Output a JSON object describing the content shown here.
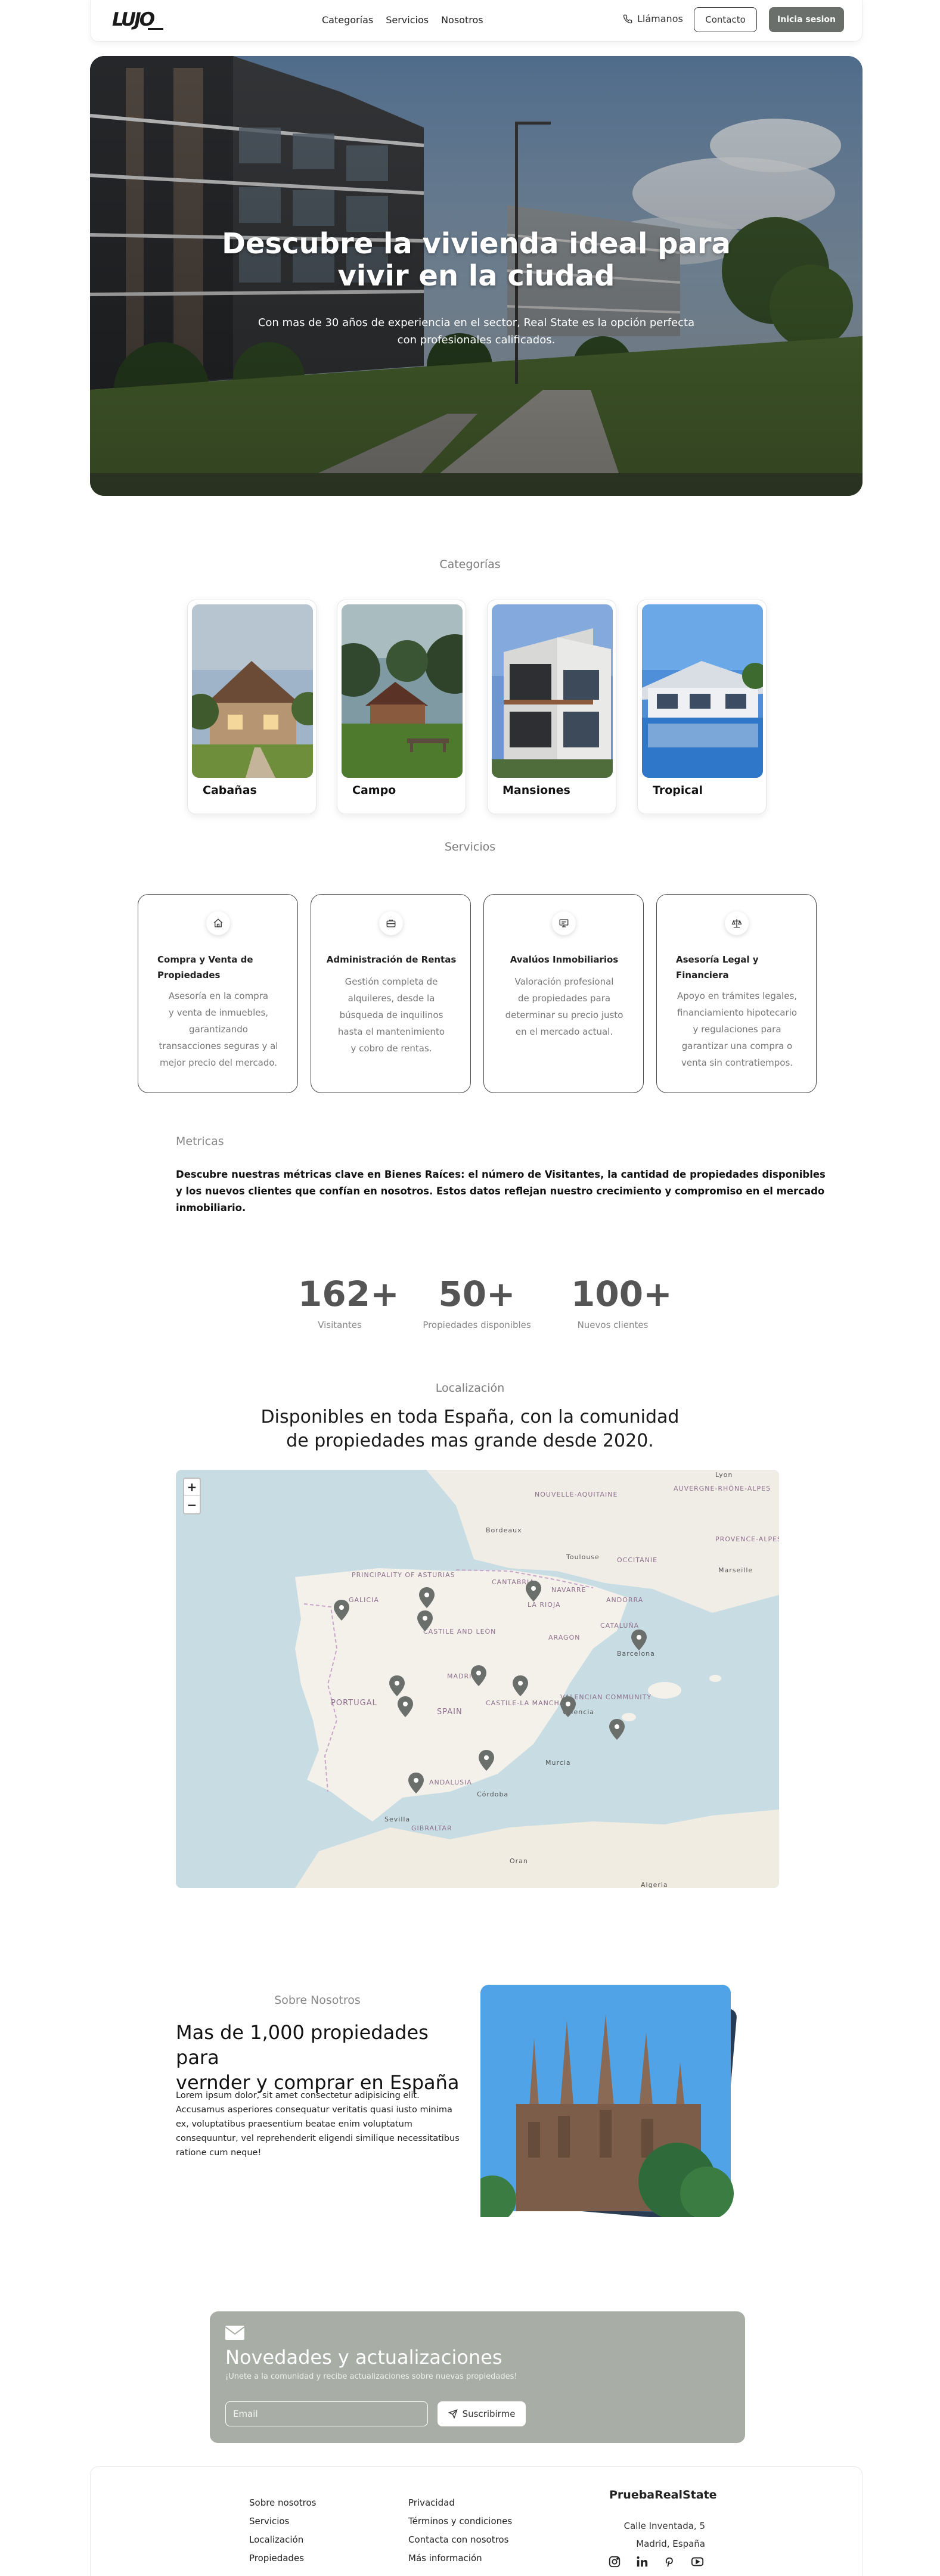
{
  "nav": {
    "logo_text": "LUJO",
    "links": [
      "Categorías",
      "Servicios",
      "Nosotros"
    ],
    "call_label": "Llámanos",
    "contact_label": "Contacto",
    "login_label": "Inicia sesion"
  },
  "hero": {
    "title_line1": "Descubre la vivienda ideal para",
    "title_line2": "vivir en la ciudad",
    "subtitle_line1": "Con mas de 30 años de experiencia en el sector, Real State es la opción perfecta",
    "subtitle_line2": "con profesionales calificados."
  },
  "categories": {
    "label": "Categorías",
    "items": [
      "Cabañas",
      "Campo",
      "Mansiones",
      "Tropical"
    ]
  },
  "services": {
    "label": "Servicios",
    "items": [
      {
        "title_lines": [
          "Compra y Venta de",
          "Propiedades"
        ],
        "icon": "home-icon",
        "desc_lines": [
          "Asesoría en la compra",
          "y venta de inmuebles,",
          "garantizando",
          "transacciones seguras y al",
          "mejor precio del mercado."
        ]
      },
      {
        "title_lines": [
          "Administración de Rentas"
        ],
        "icon": "briefcase-icon",
        "desc_lines": [
          "Gestión completa de",
          "alquileres, desde la",
          "búsqueda de inquilinos",
          "hasta el mantenimiento",
          "y cobro de rentas."
        ]
      },
      {
        "title_lines": [
          "Avalúos Inmobiliarios"
        ],
        "icon": "monitor-icon",
        "desc_lines": [
          "Valoración profesional",
          "de propiedades para",
          "determinar su precio justo",
          "en el mercado actual."
        ]
      },
      {
        "title_lines": [
          "Asesoría Legal y",
          "Financiera"
        ],
        "icon": "scale-icon",
        "desc_lines": [
          "Apoyo en trámites legales,",
          "financiamiento hipotecario",
          "y regulaciones para",
          "garantizar una compra o",
          "venta sin contratiempos."
        ]
      }
    ]
  },
  "metrics": {
    "label": "Metricas",
    "text_line1": "Descubre nuestras métricas clave en Bienes Raíces: el número de Visitantes, la cantidad de propiedades disponibles",
    "text_line2": "y los nuevos clientes que confían en nosotros. Estos datos reflejan nuestro crecimiento y compromiso en el mercado",
    "text_line3": "inmobiliario.",
    "stats": [
      {
        "value": "162+",
        "label": "Visitantes"
      },
      {
        "value": "50+",
        "label": "Propiedades disponibles"
      },
      {
        "value": "100+",
        "label": "Nuevos clientes"
      }
    ]
  },
  "location": {
    "label": "Localización",
    "title_line1": "Disponibles en toda España, con la comunidad",
    "title_line2": "de propiedades mas grande desde 2020.",
    "zoom_in": "+",
    "zoom_out": "−",
    "map_labels": [
      "GALICIA",
      "PRINCIPALITY OF ASTURIAS",
      "CANTABRIA",
      "LA RIOJA",
      "NAVARRE",
      "ANDORRA",
      "CATALUÑA",
      "ARAGÓN",
      "CASTILE AND LEÓN",
      "MADRID",
      "CASTILE-LA MANCHA",
      "VALENCIAN COMMUNITY",
      "SPAIN",
      "PORTUGAL",
      "ANDALUSIA",
      "Murcia",
      "Córdoba",
      "GIBRALTAR",
      "OCCITANIE",
      "NOUVELLE-AQUITAINE",
      "AUVERGNE-RHÔNE-ALPES",
      "PROVENCE-ALPES-CÔTE D'AZUR",
      "Lyon",
      "Bordeaux",
      "Marseille",
      "Toulouse",
      "Barcelona",
      "Valencia",
      "Sevilla",
      "Algeria",
      "Oran"
    ]
  },
  "about": {
    "label": "Sobre Nosotros",
    "title_line1": "Mas de 1,000 propiedades para",
    "title_line2": "vernder y comprar en España",
    "text_lines": [
      "Lorem ipsum dolor, sit amet consectetur adipisicing elit.",
      "Accusamus asperiores consequatur veritatis quasi iusto minima",
      "ex, voluptatibus praesentium beatae enim voluptatum",
      "consequuntur, vel reprehenderit eligendi similique necessitatibus",
      "ratione cum neque!"
    ]
  },
  "newsletter": {
    "title": "Novedades y actualizaciones",
    "subtitle": "¡Unete a la comunidad y recibe actualizaciones sobre nuevas propiedades!",
    "email_placeholder": "Email",
    "button_label": "Suscribirme"
  },
  "footer": {
    "col1": [
      "Sobre nosotros",
      "Servicios",
      "Localización",
      "Propiedades"
    ],
    "col2": [
      "Privacidad",
      "Términos y condiciones",
      "Contacta con nosotros",
      "Más información"
    ],
    "brand": "PruebaRealState",
    "address_line1": "Calle Inventada, 5",
    "address_line2": "Madrid, España",
    "socials": [
      "instagram-icon",
      "linkedin-icon",
      "pinterest-icon",
      "youtube-icon"
    ]
  },
  "colors": {
    "accent": "#6a6f6b",
    "newsletter_bg": "#a8ada5",
    "marker": "#6b6f6c"
  }
}
